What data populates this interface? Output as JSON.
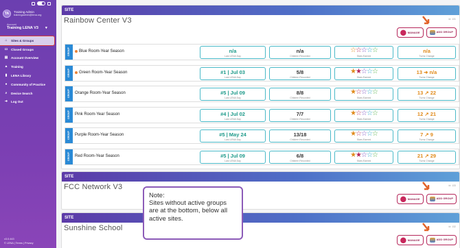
{
  "sidebar": {
    "avatar_initials": "TA",
    "user_name": "Training Admin",
    "user_email": "trainingadmin@lena.org",
    "account_label": "Account",
    "account_value": "Training LENA V3",
    "nav": [
      {
        "label": "Sites & Groups",
        "icon": "home-icon"
      },
      {
        "label": "Closed Groups",
        "icon": "folder-icon"
      },
      {
        "label": "Account Overview",
        "icon": "chart-icon"
      },
      {
        "label": "Training",
        "icon": "graduation-icon"
      },
      {
        "label": "LENA Library",
        "icon": "book-icon"
      },
      {
        "label": "Community of Practice",
        "icon": "community-icon"
      },
      {
        "label": "Device Search",
        "icon": "search-icon"
      },
      {
        "label": "Log Out",
        "icon": "logout-icon"
      }
    ],
    "version": "v3.0.443",
    "footer": "© LENA | Terms | Privacy"
  },
  "site_label": "SITE",
  "manage_label": "MANAGE",
  "add_group_label": "ADD GROUP",
  "sites": [
    {
      "name": "Rainbow Center V3",
      "id": "id: 131",
      "groups": [
        {
          "name": "Blue Room-Year Season",
          "dot": true,
          "rank": "n/a",
          "rank_sub": "Last LENA Day",
          "children": "n/a",
          "children_sub": "Children Recorded",
          "stars": 0,
          "stars_sub": "Stars Earned",
          "turns": "n/a",
          "turns_sub": "Turns Change"
        },
        {
          "name": "Green Room-Year Season",
          "dot": true,
          "rank": "#1 | Jul 03",
          "rank_sub": "Last LENA Day",
          "children": "5/8",
          "children_sub": "Children Recorded",
          "stars": 2,
          "stars_sub": "Stars Earned",
          "turns": "13 ➜ n/a",
          "turns_sub": "Turns Change"
        },
        {
          "name": "Orange Room-Year Season",
          "dot": false,
          "rank": "#5 | Jul 09",
          "rank_sub": "Last LENA Day",
          "children": "8/8",
          "children_sub": "Children Recorded",
          "stars": 1,
          "stars_sub": "Stars Earned",
          "turns": "13 ↗ 22",
          "turns_sub": "Turns Change"
        },
        {
          "name": "Pink Room-Year Season",
          "dot": false,
          "rank": "#4 | Jul 02",
          "rank_sub": "Last LENA Day",
          "children": "7/7",
          "children_sub": "Children Recorded",
          "stars": 1,
          "stars_sub": "Stars Earned",
          "turns": "12 ↗ 21",
          "turns_sub": "Turns Change"
        },
        {
          "name": "Purple Room-Year Season",
          "dot": false,
          "rank": "#5 | May 24",
          "rank_sub": "Last LENA Day",
          "children": "13/18",
          "children_sub": "Children Recorded",
          "stars": 1,
          "stars_sub": "Stars Earned",
          "turns": "7 ↗ 9",
          "turns_sub": "Turns Change"
        },
        {
          "name": "Red Room-Year Season",
          "dot": false,
          "rank": "#5 | Jul 09",
          "rank_sub": "Last LENA Day",
          "children": "6/8",
          "children_sub": "Children Recorded",
          "stars": 2,
          "stars_sub": "Stars Earned",
          "turns": "21 ↗ 29",
          "turns_sub": "Turns Change"
        }
      ]
    },
    {
      "name": "FCC Network V3",
      "id": "id: 133",
      "groups": []
    },
    {
      "name": "Sunshine School",
      "id": "id: 132",
      "groups": []
    }
  ],
  "group_tab": "GROUP",
  "note": "Note:\nSites without active groups are at the bottom, below all active sites.",
  "colors": {
    "accent": "#6b3fb0",
    "teal": "#1d9a8a",
    "orange": "#e08a1a",
    "magenta": "#b5265a"
  }
}
